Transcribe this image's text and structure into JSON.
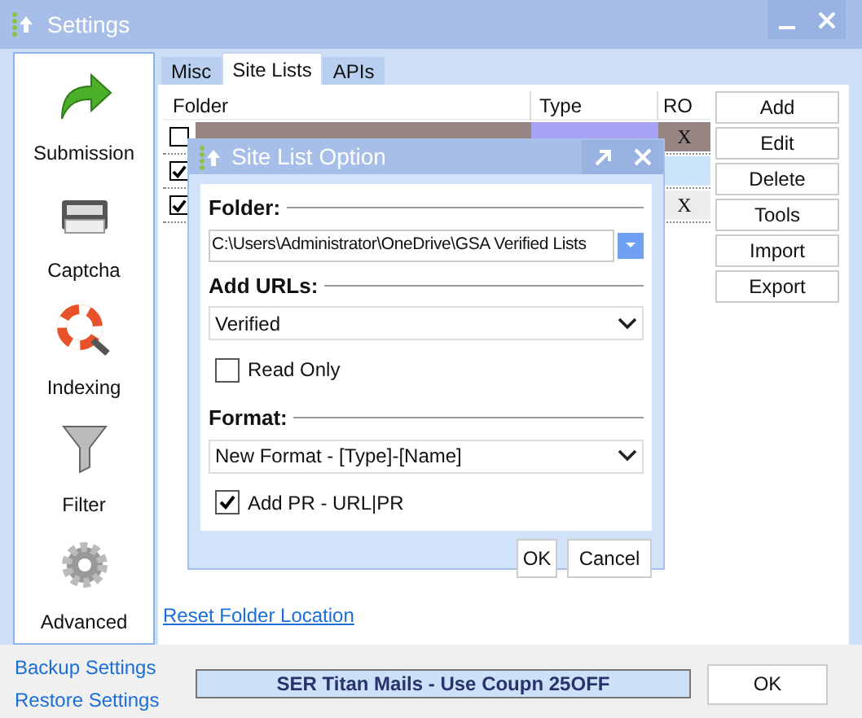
{
  "window": {
    "title": "Settings"
  },
  "sidebar": {
    "items": [
      {
        "label": "Submission",
        "kind": "arrow"
      },
      {
        "label": "Captcha",
        "kind": "captcha"
      },
      {
        "label": "Indexing",
        "kind": "indexing"
      },
      {
        "label": "Filter",
        "kind": "filter"
      },
      {
        "label": "Advanced",
        "kind": "gear"
      }
    ]
  },
  "tabs": [
    {
      "label": "Misc",
      "selected": false
    },
    {
      "label": "Site Lists",
      "selected": true
    },
    {
      "label": "APIs",
      "selected": false
    }
  ],
  "table": {
    "columns": [
      "Folder",
      "Type",
      "RO"
    ],
    "rows": [
      {
        "checked": false,
        "cells": [
          {
            "color": "#968583"
          },
          {
            "color": "#a9a3f7"
          }
        ],
        "ro": "X",
        "color": "#968583"
      },
      {
        "checked": true,
        "color": "#cce4fa"
      },
      {
        "checked": true,
        "ro": "X",
        "color": "#ececec"
      }
    ]
  },
  "buttons": [
    "Add",
    "Edit",
    "Delete",
    "Tools",
    "Import",
    "Export"
  ],
  "reset_link": "Reset Folder Location",
  "backup_link": "Backup Settings",
  "restore_link": "Restore Settings",
  "banner": "SER Titan Mails - Use Coupn 25OFF",
  "ok": "OK",
  "dialog": {
    "title": "Site List Option",
    "folder_label": "Folder:",
    "folder_value": "C:\\Users\\Administrator\\OneDrive\\GSA Verified Lists",
    "add_urls_label": "Add URLs:",
    "add_urls_value": "Verified",
    "read_only": {
      "label": "Read Only",
      "checked": false
    },
    "format_label": "Format:",
    "format_value": "New Format - [Type]-[Name]",
    "add_pr": {
      "label": "Add PR - URL|PR",
      "checked": true
    },
    "ok": "OK",
    "cancel": "Cancel"
  }
}
